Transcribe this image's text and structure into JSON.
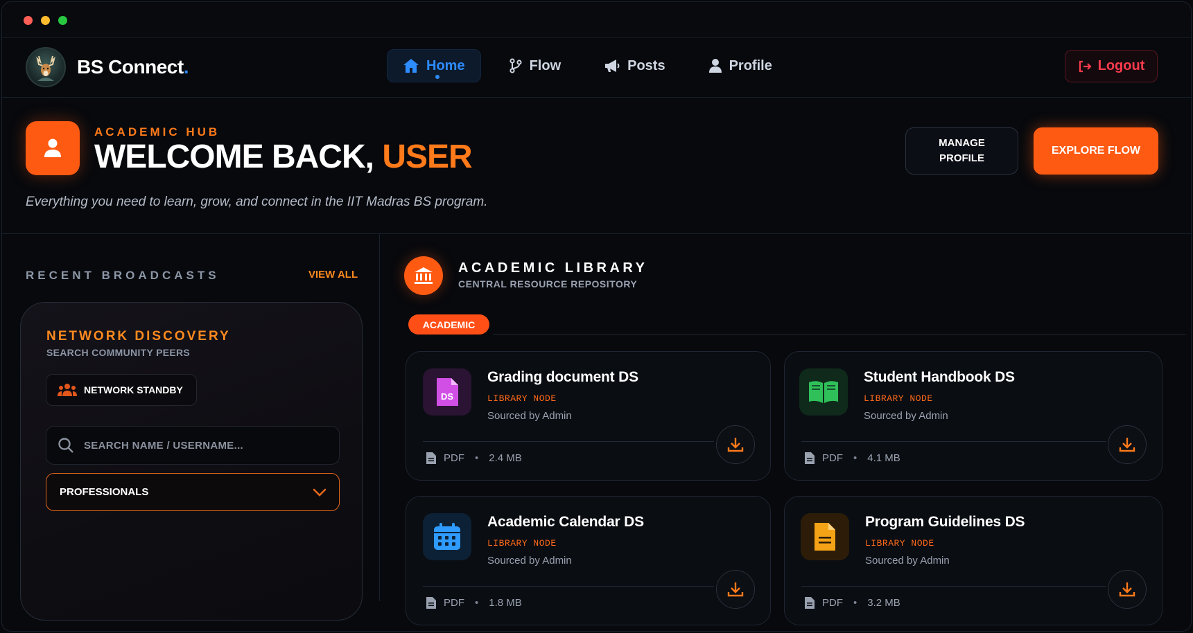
{
  "brand": {
    "name": "BS Connect",
    "dot": "."
  },
  "nav": {
    "items": [
      {
        "label": "Home",
        "icon": "home-icon",
        "active": true
      },
      {
        "label": "Flow",
        "icon": "branch-icon",
        "active": false
      },
      {
        "label": "Posts",
        "icon": "megaphone-icon",
        "active": false
      },
      {
        "label": "Profile",
        "icon": "user-icon",
        "active": false
      }
    ],
    "logout_label": "Logout"
  },
  "hero": {
    "kicker": "ACADEMIC HUB",
    "title_prefix": "WELCOME BACK, ",
    "title_user": "USER",
    "subtitle": "Everything you need to learn, grow, and connect in the IIT Madras BS program.",
    "manage_label": "MANAGE\nPROFILE",
    "explore_label": "EXPLORE FLOW"
  },
  "broadcasts": {
    "title": "RECENT BROADCASTS",
    "view_all": "VIEW ALL"
  },
  "discovery": {
    "title": "NETWORK DISCOVERY",
    "subtitle": "SEARCH COMMUNITY PEERS",
    "standby_label": "NETWORK STANDBY",
    "search_placeholder": "SEARCH NAME / USERNAME...",
    "search_value": "",
    "select_value": "PROFESSIONALS"
  },
  "library": {
    "title": "ACADEMIC LIBRARY",
    "subtitle": "CENTRAL RESOURCE REPOSITORY",
    "tab": "ACADEMIC",
    "resources": [
      {
        "title": "Grading document DS",
        "tag": "LIBRARY NODE",
        "source": "Sourced by Admin",
        "type": "PDF",
        "size": "2.4 MB",
        "icon": "pdf-file-icon",
        "thumb_bg": "#2a1333",
        "icon_color": "#d24fe6",
        "icon_text": "DS"
      },
      {
        "title": "Student Handbook DS",
        "tag": "LIBRARY NODE",
        "source": "Sourced by Admin",
        "type": "PDF",
        "size": "4.1 MB",
        "icon": "book-icon",
        "thumb_bg": "#0f2a1a",
        "icon_color": "#2fc05a"
      },
      {
        "title": "Academic Calendar DS",
        "tag": "LIBRARY NODE",
        "source": "Sourced by Admin",
        "type": "PDF",
        "size": "1.8 MB",
        "icon": "calendar-icon",
        "thumb_bg": "#0d2136",
        "icon_color": "#2f9bff"
      },
      {
        "title": "Program Guidelines DS",
        "tag": "LIBRARY NODE",
        "source": "Sourced by Admin",
        "type": "PDF",
        "size": "3.2 MB",
        "icon": "document-icon",
        "thumb_bg": "#2d1d08",
        "icon_color": "#f5a316"
      }
    ]
  },
  "colors": {
    "accent": "#ff5a12",
    "blue": "#2d8cff",
    "danger": "#ff3b4e"
  }
}
